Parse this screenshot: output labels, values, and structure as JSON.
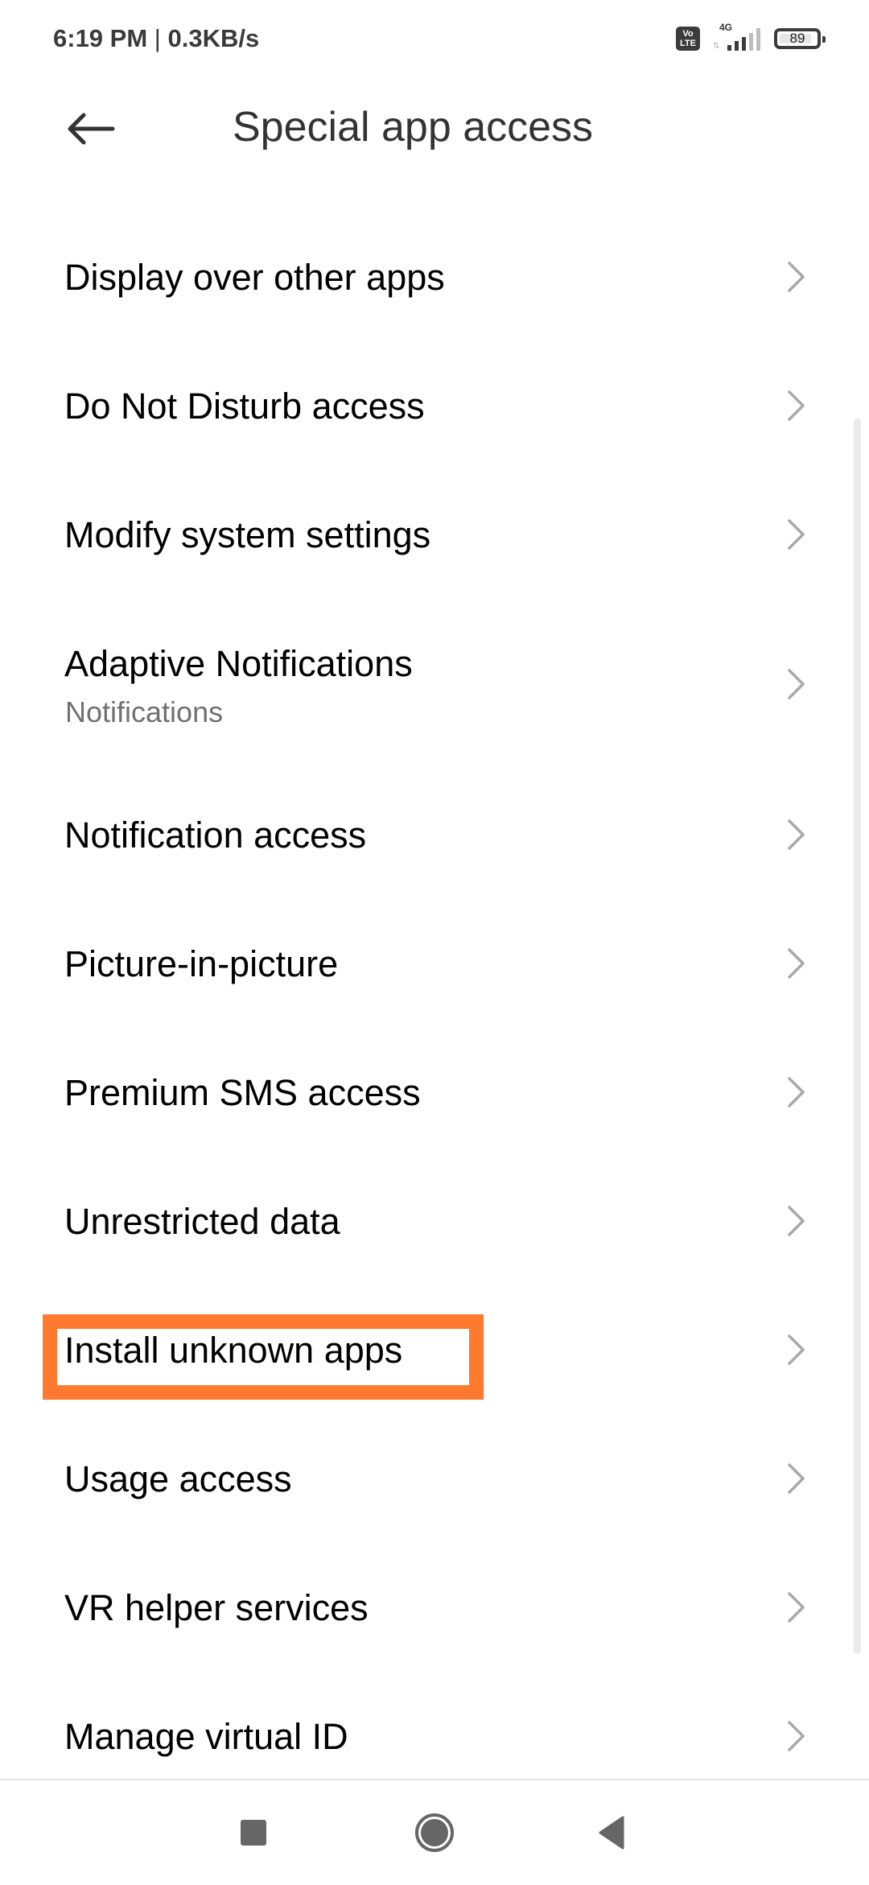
{
  "status_bar": {
    "time": "6:19 PM",
    "separator": "|",
    "net_speed": "0.3KB/s",
    "volte_line1": "Vo",
    "volte_line2": "LTE",
    "network_type": "4G",
    "signal_bars_filled": 3,
    "signal_bars_total": 5,
    "battery_level": "89"
  },
  "header": {
    "back_icon": "arrow-left-icon",
    "title": "Special app access"
  },
  "list": {
    "items": [
      {
        "label": "Display over other apps"
      },
      {
        "label": "Do Not Disturb access"
      },
      {
        "label": "Modify system settings"
      },
      {
        "label": "Adaptive Notifications",
        "subtitle": "Notifications"
      },
      {
        "label": "Notification access"
      },
      {
        "label": "Picture-in-picture"
      },
      {
        "label": "Premium SMS access"
      },
      {
        "label": "Unrestricted data"
      },
      {
        "label": "Install unknown apps",
        "highlighted": true
      },
      {
        "label": "Usage access"
      },
      {
        "label": "VR helper services"
      },
      {
        "label": "Manage virtual ID"
      }
    ],
    "chevron_icon": "chevron-right-icon"
  },
  "highlight_color": "#ff7a2e",
  "navbar": {
    "recent_icon": "square-icon",
    "home_icon": "circle-icon",
    "back_icon": "triangle-back-icon"
  }
}
